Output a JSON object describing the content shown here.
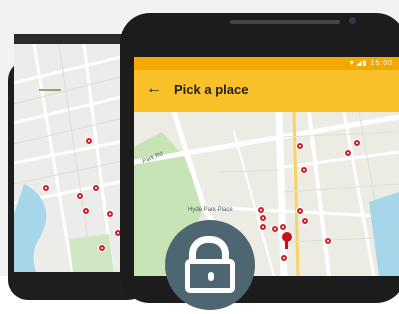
{
  "header": {
    "title": "Pick a place",
    "back_icon": "back-arrow-icon"
  },
  "status_bar": {
    "icons": "▼◢▮",
    "time": "15:00"
  },
  "map": {
    "place_label": "Hyde Park Place",
    "street_label": "Park Rd"
  },
  "badge": {
    "icon": "lock-icon"
  },
  "colors": {
    "app_bar": "#f9c02a",
    "status_bar": "#f2a900",
    "pin": "#d21e28",
    "badge": "#4d6672"
  }
}
